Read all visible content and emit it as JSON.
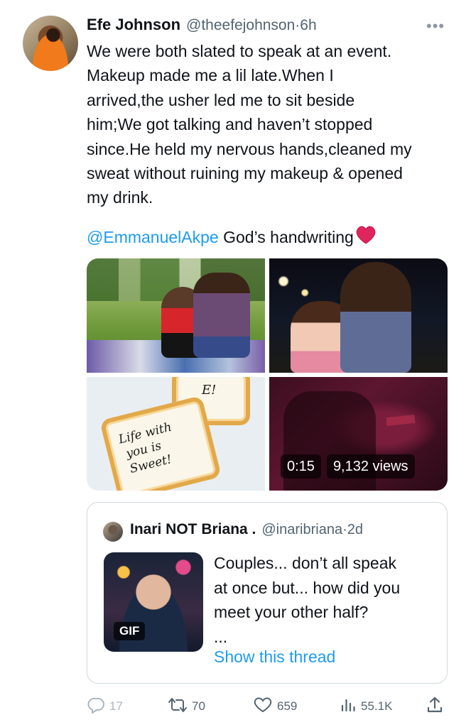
{
  "tweet": {
    "display_name": "Efe Johnson",
    "handle": "@theefejohnson",
    "separator": "·",
    "time": "6h",
    "more_icon": "more-dots-icon",
    "body_lines": [
      "We were both slated to speak at an event.",
      "Makeup made me a lil late.When I",
      "arrived,the usher led me to sit beside",
      "him;We got talking and haven’t stopped",
      "since.He held my nervous hands,cleaned my",
      "sweat without ruining my makeup & opened",
      "my drink."
    ],
    "mention": "@EmmanuelAkpe",
    "mention_suffix": " God’s handwriting"
  },
  "media": {
    "cookie_top_text": "E!",
    "cookie_main_text": "Life with\n you is\n Sweet!",
    "video_duration": "0:15",
    "video_views": "9,132 views"
  },
  "quoted_tweet": {
    "display_name": "Inari NOT Briana .",
    "handle": "@inaribriana",
    "separator": "·",
    "time": "2d",
    "gif_label": "GIF",
    "text_lines": [
      "Couples... don’t all speak",
      "at once but... how did you",
      "meet your other half?",
      "..."
    ],
    "show_thread": "Show this thread"
  },
  "actions": {
    "reply_count": "17",
    "retweet_count": "70",
    "like_count": "659",
    "view_count": "55.1K"
  },
  "colors": {
    "accent": "#1d9bf0",
    "text_primary": "#0f1419",
    "text_secondary": "#536471",
    "heart": "#e0245e"
  }
}
